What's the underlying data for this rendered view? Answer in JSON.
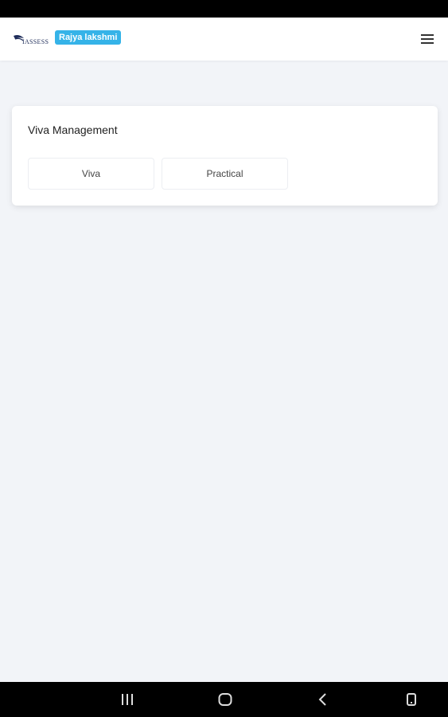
{
  "header": {
    "logo_text": "IASSESS",
    "user_name": "Rajya lakshmi",
    "menu_icon": "hamburger-menu-icon"
  },
  "card": {
    "title": "Viva Management",
    "tabs": [
      {
        "label": "Viva"
      },
      {
        "label": "Practical"
      }
    ]
  },
  "navigation": {
    "icons": [
      "recent-apps-icon",
      "home-icon",
      "back-icon",
      "rotate-icon"
    ]
  },
  "colors": {
    "badge": "#35b3e8",
    "background": "#f2f4f8",
    "card": "#ffffff"
  }
}
